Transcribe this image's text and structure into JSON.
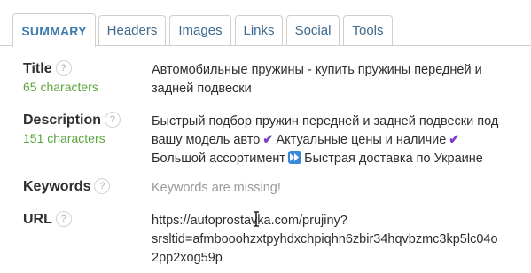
{
  "tabs": [
    {
      "label": "SUMMARY",
      "active": true
    },
    {
      "label": "Headers",
      "active": false
    },
    {
      "label": "Images",
      "active": false
    },
    {
      "label": "Links",
      "active": false
    },
    {
      "label": "Social",
      "active": false
    },
    {
      "label": "Tools",
      "active": false
    }
  ],
  "rows": {
    "title": {
      "label": "Title",
      "count": "65 characters",
      "line1": "Автомобильные пружины - купить пружины передней и",
      "line2": "задней подвески"
    },
    "description": {
      "label": "Description",
      "count": "151 characters",
      "line1": "Быстрый подбор пружин передней и задней подвески под",
      "line2a": "вашу модель авто",
      "line2b": "Актуальные цены и наличие",
      "line3a": "Большой ассортимент",
      "line3b": "Быстрая доставка по Украине"
    },
    "keywords": {
      "label": "Keywords",
      "value": "Keywords are missing!"
    },
    "url": {
      "label": "URL",
      "line1": "https://autoprostavka.com/prujiny?",
      "line2": "srsltid=afmbooohzxtpyhdxchpiqhn6zbir34hqvbzmc3kp5lc04o",
      "line3": "2pp2xog59p"
    }
  },
  "help_glyph": "?",
  "icons": {
    "help": "question-circle-icon",
    "check": "check-mark-icon",
    "fast_forward": "fast-forward-icon",
    "cursor": "text-cursor-icon"
  },
  "colors": {
    "tab_text": "#3d6a8e",
    "active_tab_text": "#3d7bb0",
    "count_green": "#5ba63c",
    "missing_gray": "#9a9a9a",
    "check_purple": "#7a3fc4",
    "ff_blue": "#3b8ad9"
  }
}
